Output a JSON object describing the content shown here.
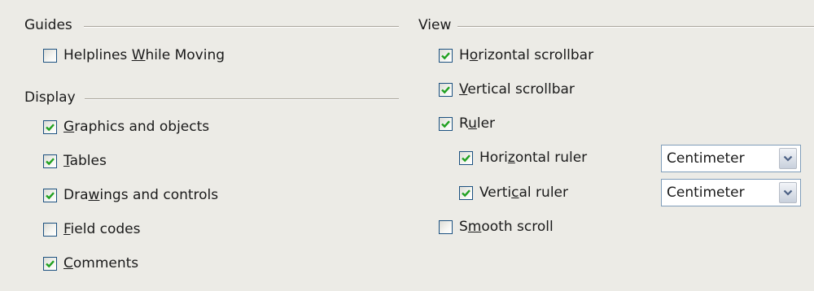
{
  "guides": {
    "title": "Guides",
    "helplines": {
      "pre": "Helplines ",
      "acc": "W",
      "post": "hile Moving",
      "checked": false
    }
  },
  "display": {
    "title": "Display",
    "items": [
      {
        "pre": "",
        "acc": "G",
        "post": "raphics and objects",
        "checked": true
      },
      {
        "pre": "",
        "acc": "T",
        "post": "ables",
        "checked": true
      },
      {
        "pre": "Dra",
        "acc": "w",
        "post": "ings and controls",
        "checked": true
      },
      {
        "pre": "",
        "acc": "F",
        "post": "ield codes",
        "checked": false
      },
      {
        "pre": "",
        "acc": "C",
        "post": "omments",
        "checked": true
      }
    ]
  },
  "view": {
    "title": "View",
    "horizontal_scrollbar": {
      "pre": "H",
      "acc": "o",
      "post": "rizontal scrollbar",
      "checked": true
    },
    "vertical_scrollbar": {
      "pre": "",
      "acc": "V",
      "post": "ertical scrollbar",
      "checked": true
    },
    "ruler": {
      "pre": "R",
      "acc": "u",
      "post": "ler",
      "checked": true
    },
    "horizontal_ruler": {
      "pre": "Hori",
      "acc": "z",
      "post": "ontal ruler",
      "checked": true,
      "unit": "Centimeter"
    },
    "vertical_ruler": {
      "pre": "Verti",
      "acc": "c",
      "post": "al ruler",
      "checked": true,
      "unit": "Centimeter"
    },
    "smooth_scroll": {
      "pre": "S",
      "acc": "m",
      "post": "ooth scroll",
      "checked": false
    }
  },
  "colors": {
    "check": "#21a121",
    "checkbox_border": "#1c5180",
    "background": "#ecebe6"
  }
}
